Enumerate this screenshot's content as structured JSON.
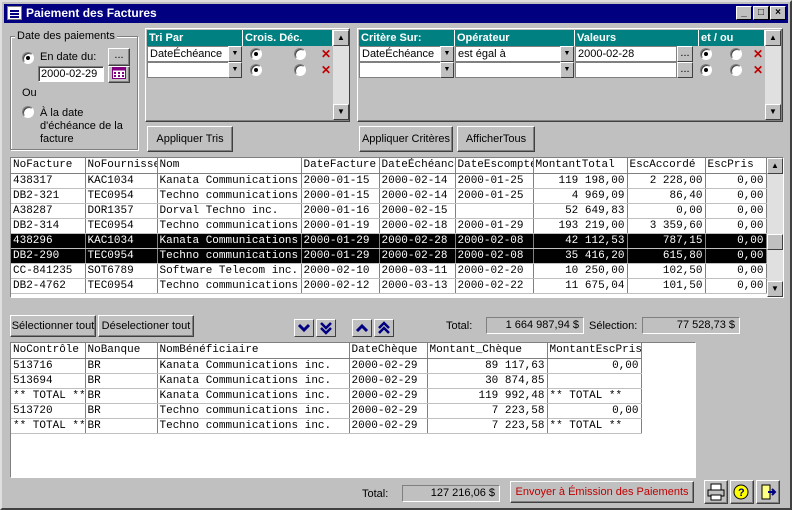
{
  "window": {
    "title": "Paiement des Factures"
  },
  "date_group": {
    "label": "Date des paiements",
    "opt1": "En date du:",
    "date_value": "2000-02-29",
    "ou": "Ou",
    "opt2": "À la date d'échéance de la facture"
  },
  "sort": {
    "col_tri": "Tri Par",
    "col_crois": "Crois. Déc.",
    "row1_value": "DateÉchéance",
    "button": "Appliquer Tris"
  },
  "criteria": {
    "col_critere": "Critère Sur:",
    "col_operateur": "Opérateur",
    "col_valeurs": "Valeurs",
    "col_etou": "et / ou",
    "row1_critere": "DateÉchéance",
    "row1_operateur": "est égal à",
    "row1_valeur": "2000-02-28",
    "btn_apply": "Appliquer Critères",
    "btn_show_all": "AfficherTous"
  },
  "invoices": {
    "headers": [
      "NoFacture",
      "NoFournisseur",
      "Nom",
      "DateFacture",
      "DateÉchéance",
      "DateEscompte",
      "MontantTotal",
      "EscAccordé",
      "EscPris"
    ],
    "rows": [
      {
        "no": "438317",
        "four": "KAC1034",
        "nom": "Kanata Communications inc.",
        "datef": "2000-01-15",
        "datee": "2000-02-14",
        "datex": "2000-01-25",
        "montant": "119 198,00",
        "esc": "2 228,00",
        "pris": "0,00",
        "sel": false
      },
      {
        "no": "DB2-321",
        "four": "TEC0954",
        "nom": "Techno communications",
        "datef": "2000-01-15",
        "datee": "2000-02-14",
        "datex": "2000-01-25",
        "montant": "4 969,09",
        "esc": "86,40",
        "pris": "0,00",
        "sel": false
      },
      {
        "no": "A38287",
        "four": "DOR1357",
        "nom": "Dorval Techno inc.",
        "datef": "2000-01-16",
        "datee": "2000-02-15",
        "datex": "",
        "montant": "52 649,83",
        "esc": "0,00",
        "pris": "0,00",
        "sel": false
      },
      {
        "no": "DB2-314",
        "four": "TEC0954",
        "nom": "Techno communications",
        "datef": "2000-01-19",
        "datee": "2000-02-18",
        "datex": "2000-01-29",
        "montant": "193 219,00",
        "esc": "3 359,60",
        "pris": "0,00",
        "sel": false
      },
      {
        "no": "438296",
        "four": "KAC1034",
        "nom": "Kanata Communications inc.",
        "datef": "2000-01-29",
        "datee": "2000-02-28",
        "datex": "2000-02-08",
        "montant": "42 112,53",
        "esc": "787,15",
        "pris": "0,00",
        "sel": true
      },
      {
        "no": "DB2-290",
        "four": "TEC0954",
        "nom": "Techno communications",
        "datef": "2000-01-29",
        "datee": "2000-02-28",
        "datex": "2000-02-08",
        "montant": "35 416,20",
        "esc": "615,80",
        "pris": "0,00",
        "sel": true
      },
      {
        "no": "CC-841235",
        "four": "SOT6789",
        "nom": "Software Telecom inc.",
        "datef": "2000-02-10",
        "datee": "2000-03-11",
        "datex": "2000-02-20",
        "montant": "10 250,00",
        "esc": "102,50",
        "pris": "0,00",
        "sel": false
      },
      {
        "no": "DB2-4762",
        "four": "TEC0954",
        "nom": "Techno communications",
        "datef": "2000-02-12",
        "datee": "2000-03-13",
        "datex": "2000-02-22",
        "montant": "11 675,04",
        "esc": "101,50",
        "pris": "0,00",
        "sel": false
      }
    ]
  },
  "selection_bar": {
    "btn_select_all": "Sélectionner tout",
    "btn_deselect_all": "Déselectioner tout",
    "total_label": "Total:",
    "total_value": "1 664 987,94 $",
    "selection_label": "Sélection:",
    "selection_value": "77 528,73 $"
  },
  "payments": {
    "headers": [
      "NoContrôle",
      "NoBanque",
      "NomBénéficiaire",
      "DateChèque",
      "Montant_Chèque",
      "MontantEscPris"
    ],
    "rows": [
      {
        "ctrl": "513716",
        "banque": "BR",
        "nom": "Kanata Communications inc.",
        "date": "2000-02-29",
        "montant": "89 117,63",
        "esc": "0,00"
      },
      {
        "ctrl": "513694",
        "banque": "BR",
        "nom": "Kanata Communications inc.",
        "date": "2000-02-29",
        "montant": "30 874,85",
        "esc": ""
      },
      {
        "ctrl": "** TOTAL **",
        "banque": "BR",
        "nom": "Kanata Communications inc.",
        "date": "2000-02-29",
        "montant": "119 992,48",
        "esc": "** TOTAL **"
      },
      {
        "ctrl": "513720",
        "banque": "BR",
        "nom": "Techno communications inc.",
        "date": "2000-02-29",
        "montant": "7 223,58",
        "esc": "0,00"
      },
      {
        "ctrl": "** TOTAL **",
        "banque": "BR",
        "nom": "Techno communications inc.",
        "date": "2000-02-29",
        "montant": "7 223,58",
        "esc": "** TOTAL **"
      }
    ]
  },
  "footer": {
    "total_label": "Total:",
    "total_value": "127 216,06 $",
    "send_button": "Envoyer à Émission des Paiements"
  },
  "colors": {
    "title_bar": "#000080",
    "header_teal": "#008080",
    "send_text": "#c00000"
  }
}
